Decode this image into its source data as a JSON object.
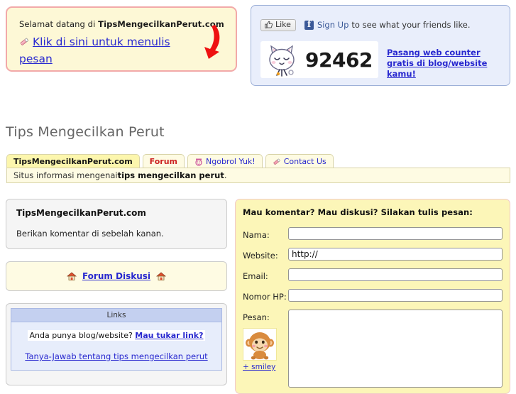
{
  "welcome": {
    "greeting_prefix": "Selamat datang di ",
    "site_name": "TipsMengecilkanPerut.com",
    "cta_link": "Klik di sini untuk menulis pesan",
    "pencil_icon": "pencil-icon",
    "arrow_icon": "curved-red-arrow-icon",
    "border_color": "#f2a9a9",
    "background_color": "#fdf8d6"
  },
  "social": {
    "like_label": "Like",
    "thumb_icon": "thumbs-up-icon",
    "facebook_icon": "facebook-f-icon",
    "signup_label": "Sign Up",
    "signup_suffix": "to see what your friends like.",
    "brand_color": "#3b5998",
    "panel_background": "#e9eefb",
    "panel_border": "#9db0d8"
  },
  "counter": {
    "value": "92462",
    "cat_icon": "cat-mascot-icon",
    "promo_link": "Pasang web counter gratis di blog/website kamu!",
    "link_color": "#2828cf"
  },
  "page": {
    "title": "Tips Mengecilkan Peru t",
    "title_text": "Tips Mengecilkan Perut"
  },
  "tabs": {
    "items": [
      {
        "label": "TipsMengecilkanPerut.com",
        "active": true,
        "icon": null,
        "style": "active"
      },
      {
        "label": "Forum",
        "active": false,
        "icon": null,
        "style": "forum"
      },
      {
        "label": "Ngobrol Yuk!",
        "active": false,
        "icon": "chat-emoticon-icon",
        "style": "link"
      },
      {
        "label": "Contact Us",
        "active": false,
        "icon": "pencil-icon",
        "style": "link"
      }
    ],
    "content_prefix": "Situs informasi mengenai ",
    "content_bold": "tips mengecilkan perut",
    "content_suffix": ".",
    "tab_background": "#fefbe3",
    "tab_active_background": "#fcf6ad",
    "tab_border": "#d9d4a8"
  },
  "sidebar": {
    "about": {
      "title": "TipsMengecilkanPerut.com",
      "text": "Berikan komentar di sebelah kanan."
    },
    "forum_box": {
      "link_label": "Forum Diskusi",
      "icon_left": "house-icon",
      "icon_right": "house-icon"
    },
    "links_box": {
      "header": "Links",
      "row1_text": "Anda punya blog/website? ",
      "row1_link": "Mau tukar link?",
      "row2_link": "Tanya-Jawab tentang tips mengecilkan perut",
      "header_background": "#c4d0f0",
      "body_background": "#e7edfb"
    }
  },
  "form": {
    "heading": "Mau komentar? Mau diskusi? Silakan tulis pesan:",
    "fields": [
      {
        "label": "Nama:",
        "value": "",
        "placeholder": ""
      },
      {
        "label": "Website:",
        "value": "http://",
        "placeholder": ""
      },
      {
        "label": "Email:",
        "value": "",
        "placeholder": ""
      },
      {
        "label": "Nomor HP:",
        "value": "",
        "placeholder": ""
      }
    ],
    "message_label": "Pesan:",
    "message_value": "",
    "smiley_icon": "monkey-smiley-icon",
    "smiley_link": "+ smiley",
    "panel_background": "#fcf6b8",
    "panel_border": "#f2c9c9"
  }
}
